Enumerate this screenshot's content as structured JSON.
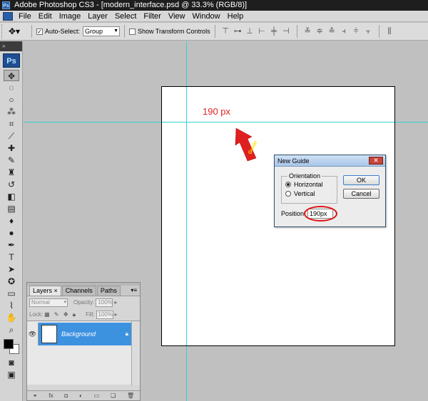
{
  "window": {
    "title": "Adobe Photoshop CS3 - [modern_interface.psd @ 33.3% (RGB/8)]",
    "app_icon": "Ps"
  },
  "menu": [
    "File",
    "Edit",
    "Image",
    "Layer",
    "Select",
    "Filter",
    "View",
    "Window",
    "Help"
  ],
  "options_bar": {
    "auto_select_label": "Auto-Select:",
    "auto_select_checked": true,
    "auto_select_value": "Group",
    "show_transform_label": "Show Transform Controls",
    "show_transform_checked": false
  },
  "toolbox": {
    "logo": "Ps"
  },
  "canvas": {
    "annotation_label": "190 px",
    "arrow_label": "Guide",
    "arrow_color": "#e02020"
  },
  "dialog": {
    "title": "New Guide",
    "orientation_legend": "Orientation",
    "horizontal_label": "Horizontal",
    "vertical_label": "Vertical",
    "selected_orientation": "Horizontal",
    "ok_label": "OK",
    "cancel_label": "Cancel",
    "position_label": "Position:",
    "position_value": "190px",
    "highlight_color": "#e01010"
  },
  "layers_panel": {
    "tabs": [
      "Layers",
      "Channels",
      "Paths"
    ],
    "active_tab": "Layers",
    "blend_mode": "Normal",
    "opacity_label": "Opacity:",
    "opacity_value": "100%",
    "lock_label": "Lock:",
    "fill_label": "Fill:",
    "fill_value": "100%",
    "layers": [
      {
        "name": "Background",
        "visible": true,
        "locked": true,
        "selected": true
      }
    ]
  },
  "colors": {
    "guide": "#35d0d0",
    "selection": "#3d92e0"
  }
}
